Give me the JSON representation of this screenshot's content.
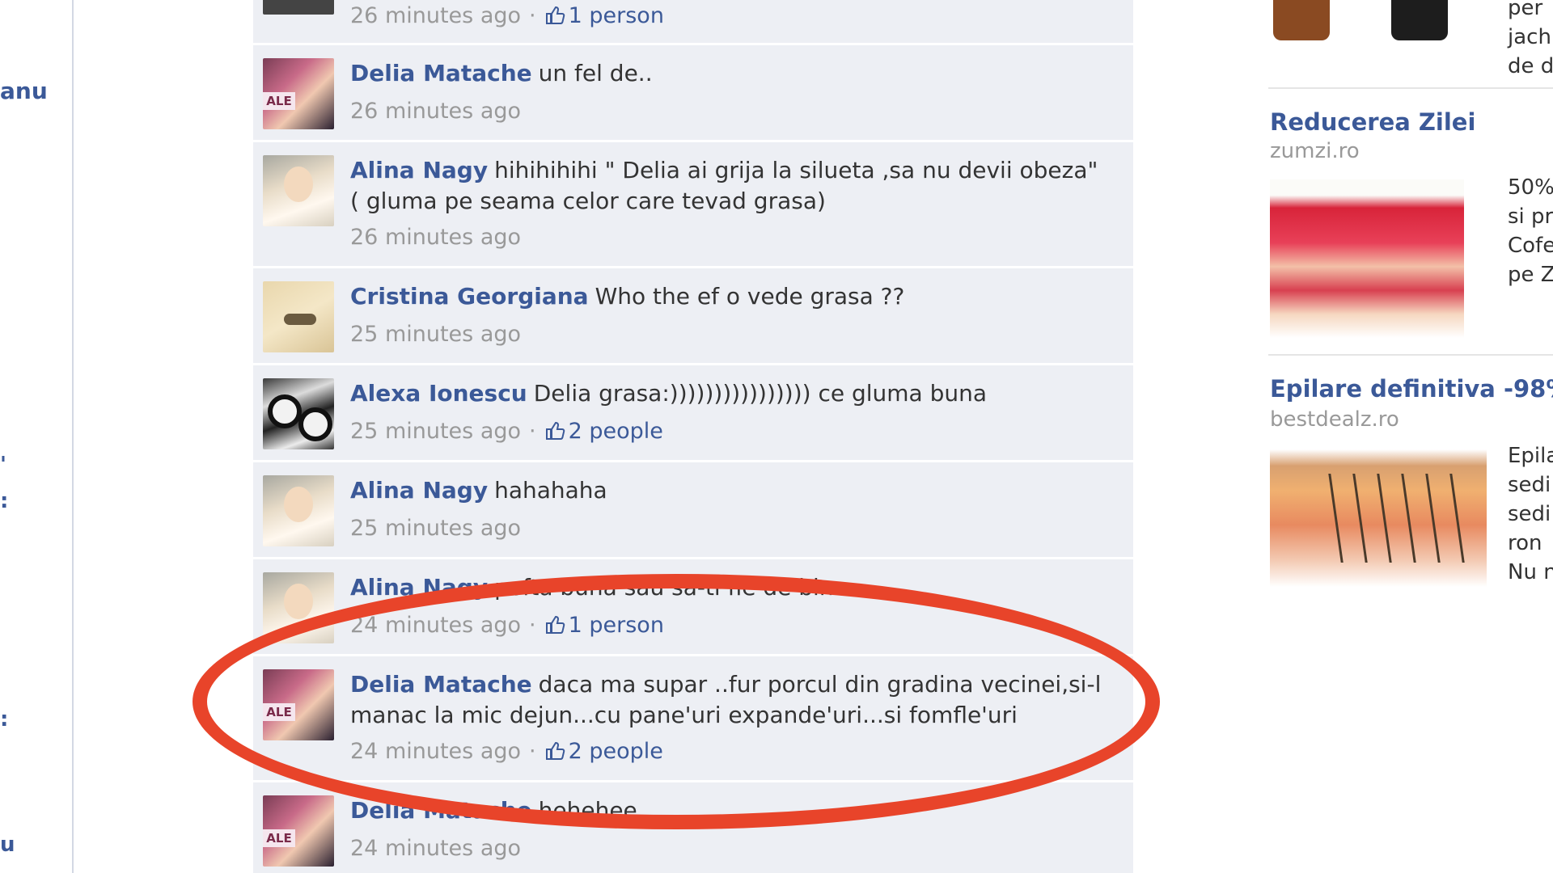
{
  "left_nav": {
    "name_fragment": "anu",
    "marks": [
      "'",
      ":",
      ":",
      "u"
    ]
  },
  "comments": [
    {
      "author": "",
      "text": "",
      "time": "26 minutes ago",
      "likes": "1 person",
      "avatar": "jacket"
    },
    {
      "author": "Delia Matache",
      "text": "un fel de..",
      "time": "26 minutes ago",
      "likes": "",
      "avatar": "delia"
    },
    {
      "author": "Alina Nagy",
      "text": "hihihihihi \" Delia ai grija la silueta ,sa nu devii obeza\" ( gluma pe seama celor care tevad grasa)",
      "time": "26 minutes ago",
      "likes": "",
      "avatar": "alina"
    },
    {
      "author": "Cristina Georgiana",
      "text": "Who the ef o vede grasa ??",
      "time": "25 minutes ago",
      "likes": "",
      "avatar": "cristina"
    },
    {
      "author": "Alexa Ionescu",
      "text": "Delia grasa:)))))))))))))))) ce gluma buna",
      "time": "25 minutes ago",
      "likes": "2 people",
      "avatar": "alexa"
    },
    {
      "author": "Alina Nagy",
      "text": "hahahaha",
      "time": "25 minutes ago",
      "likes": "",
      "avatar": "alina"
    },
    {
      "author": "Alina Nagy",
      "text": "pofta buna sau sa-ti fie de bine",
      "time": "24 minutes ago",
      "likes": "1 person",
      "avatar": "alina"
    },
    {
      "author": "Delia Matache",
      "text": "daca ma supar ..fur porcul din gradina vecinei,si-l manac la mic dejun...cu pane'uri expande'uri...si fomfle'uri",
      "time": "24 minutes ago",
      "likes": "2 people",
      "avatar": "delia"
    },
    {
      "author": "Delia Matache",
      "text": "hehehee",
      "time": "24 minutes ago",
      "likes": "",
      "avatar": "delia"
    }
  ],
  "ads": [
    {
      "title": "",
      "domain": "",
      "body": [
        "per",
        "jach",
        "de d"
      ]
    },
    {
      "title": "Reducerea Zilei",
      "domain": "zumzi.ro",
      "body": [
        "50%",
        "si pr",
        "Cofe",
        "pe Z"
      ]
    },
    {
      "title": "Epilare definitiva -98%",
      "domain": "bestdealz.ro",
      "body": [
        "Epila",
        "sedi",
        "sedi",
        "ron",
        "Nu n"
      ]
    }
  ],
  "colors": {
    "link": "#3b5998",
    "comment_bg": "#edeff4",
    "highlight": "#e8442a",
    "meta": "#999999"
  },
  "icons": {
    "like": "thumbs-up-icon"
  }
}
